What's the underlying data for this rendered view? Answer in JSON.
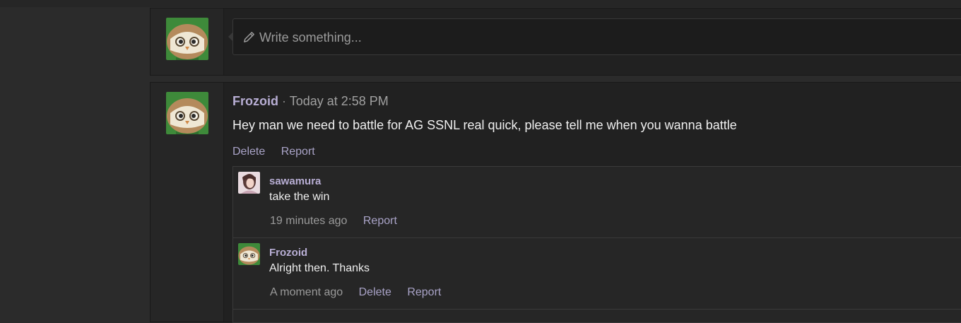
{
  "composer": {
    "placeholder": "Write something...",
    "icon": "pencil-icon"
  },
  "post": {
    "author": "Frozoid",
    "separator": "·",
    "timestamp": "Today at 2:58 PM",
    "message": "Hey man we need to battle for AG SSNL real quick, please tell me when you wanna battle",
    "actions": {
      "delete": "Delete",
      "report": "Report"
    }
  },
  "comments": [
    {
      "author": "sawamura",
      "text": "take the win",
      "time": "19 minutes ago",
      "actions": {
        "report": "Report"
      }
    },
    {
      "author": "Frozoid",
      "text": "Alright then. Thanks",
      "time": "A moment ago",
      "actions": {
        "delete": "Delete",
        "report": "Report"
      }
    }
  ],
  "colors": {
    "username": "#b8aed4",
    "link": "#a9a3c7",
    "background": "#2b2b2b"
  }
}
